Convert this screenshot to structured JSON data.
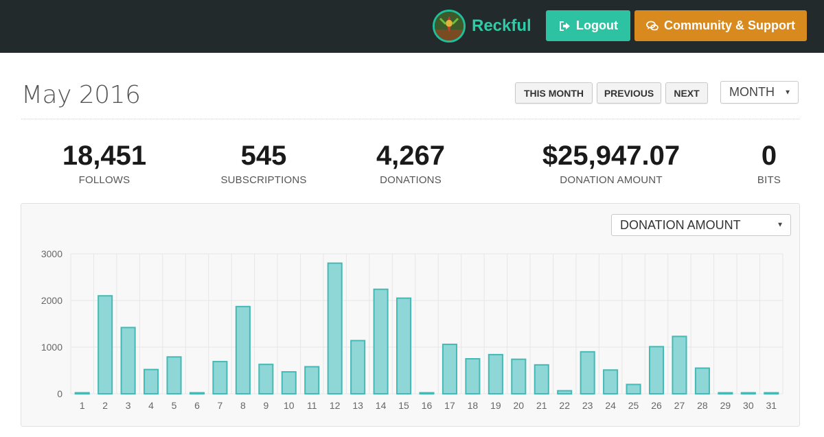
{
  "header": {
    "username": "Reckful",
    "logout_label": "Logout",
    "support_label": "Community & Support",
    "colors": {
      "bar": "#232a2b",
      "logout": "#2dc3a2",
      "support": "#d98a1e",
      "username": "#2fcba6"
    },
    "icons": {
      "logout": "sign-out-icon",
      "support": "chat-bubbles-icon"
    }
  },
  "title": "May 2016",
  "nav": {
    "this_month": "THIS MONTH",
    "previous": "PREVIOUS",
    "next": "NEXT",
    "period_select": "MONTH"
  },
  "stats": [
    {
      "value": "18,451",
      "label": "FOLLOWS"
    },
    {
      "value": "545",
      "label": "SUBSCRIPTIONS"
    },
    {
      "value": "4,267",
      "label": "DONATIONS"
    },
    {
      "value": "$25,947.07",
      "label": "DONATION AMOUNT"
    },
    {
      "value": "0",
      "label": "BITS"
    }
  ],
  "metric_select": "DONATION AMOUNT",
  "chart_data": {
    "type": "bar",
    "categories": [
      "1",
      "2",
      "3",
      "4",
      "5",
      "6",
      "7",
      "8",
      "9",
      "10",
      "11",
      "12",
      "13",
      "14",
      "15",
      "16",
      "17",
      "18",
      "19",
      "20",
      "21",
      "22",
      "23",
      "24",
      "25",
      "26",
      "27",
      "28",
      "29",
      "30",
      "31"
    ],
    "values": [
      5,
      2100,
      1420,
      520,
      790,
      15,
      690,
      1870,
      630,
      470,
      580,
      2800,
      1140,
      2240,
      2050,
      10,
      1060,
      750,
      840,
      740,
      620,
      65,
      900,
      510,
      200,
      1010,
      1230,
      550,
      5,
      5,
      5
    ],
    "ylim": [
      0,
      3000
    ],
    "yticks": [
      "0",
      "1000",
      "2000",
      "3000"
    ],
    "grid": true,
    "colors": {
      "fill": "#8fd6d6",
      "stroke": "#44b9b5"
    }
  }
}
